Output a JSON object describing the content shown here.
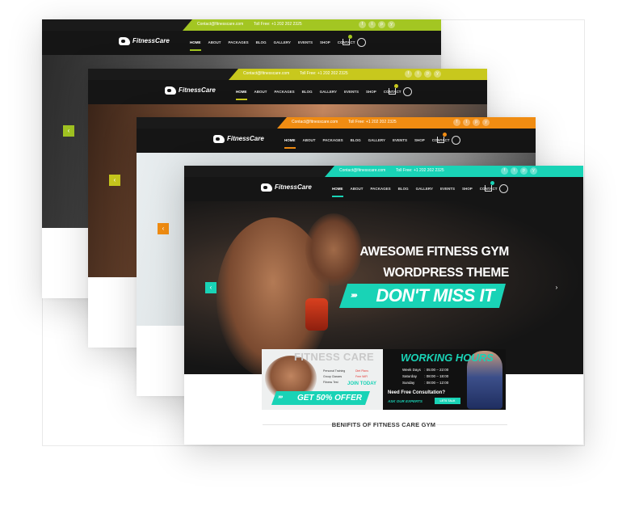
{
  "screens": [
    {
      "id": "green",
      "accent": "#a3c622",
      "contact_email": "Contact@fitnesscare.com",
      "toll_free": "Toll Free: +1 202 202 2325",
      "social": [
        "f",
        "t",
        "p",
        "y"
      ],
      "brand": "FitnessCare",
      "menu": [
        "HOME",
        "ABOUT",
        "PACKAGES",
        "BLOG",
        "GALLERY",
        "EVENTS",
        "SHOP",
        "CONTACT"
      ]
    },
    {
      "id": "yellow",
      "accent": "#c8c81d",
      "contact_email": "Contact@fitnesscare.com",
      "toll_free": "Toll Free: +1 202 202 2325",
      "social": [
        "f",
        "t",
        "p",
        "y"
      ],
      "brand": "FitnessCare",
      "menu": [
        "HOME",
        "ABOUT",
        "PACKAGES",
        "BLOG",
        "GALLERY",
        "EVENTS",
        "SHOP",
        "CONTACT"
      ]
    },
    {
      "id": "orange",
      "accent": "#f08c12",
      "contact_email": "Contact@fitnesscare.com",
      "toll_free": "Toll Free: +1 202 202 2325",
      "social": [
        "f",
        "t",
        "p",
        "y"
      ],
      "brand": "FitnessCare",
      "menu": [
        "HOME",
        "ABOUT",
        "PACKAGES",
        "BLOG",
        "GALLERY",
        "EVENTS",
        "SHOP",
        "CONTACT"
      ]
    },
    {
      "id": "teal",
      "accent": "#19d3b6",
      "contact_email": "Contact@fitnesscare.com",
      "toll_free": "Toll Free: +1 202 202 2325",
      "social": [
        "f",
        "t",
        "p",
        "y"
      ],
      "brand": "FitnessCare",
      "menu": [
        "HOME",
        "ABOUT",
        "PACKAGES",
        "BLOG",
        "GALLERY",
        "EVENTS",
        "SHOP",
        "CONTACT"
      ]
    }
  ],
  "hero": {
    "headline_line1": "AWESOME FITNESS GYM",
    "headline_line2": "WORDPRESS THEME",
    "cta": "DON'T MISS IT",
    "arrow_left": "‹",
    "arrow_right": "›"
  },
  "promo": {
    "title": "FITNESS CARE",
    "services": [
      "Personal Training",
      "Group Classes",
      "Fitness Test"
    ],
    "extras": [
      "Diet Plans",
      "Free WiFi",
      "Free WiFi"
    ],
    "join": "JOIN TODAY",
    "offer": "GET 50% OFFER",
    "hours_title": "WORKING HOURS",
    "hours": [
      {
        "day": "Week Days",
        "time": "05:00 – 22:00"
      },
      {
        "day": "Saturday",
        "time": "08:00 – 18:00"
      },
      {
        "day": "Sunday",
        "time": "08:00 – 12:00"
      }
    ],
    "consult": "Need Free Consultation?",
    "ask": "ASK OUR EXPERTS",
    "lets_talk": "LETS TALK"
  },
  "section_title": "BENIFITS OF FITNESS CARE GYM"
}
